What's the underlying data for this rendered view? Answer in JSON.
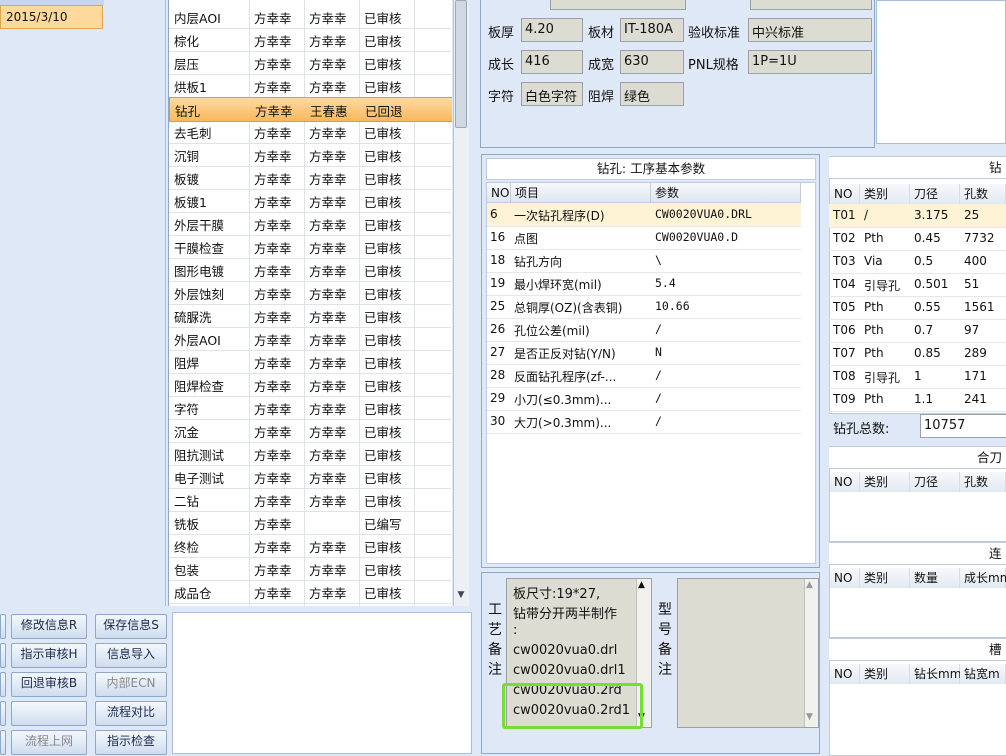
{
  "left_panel": {
    "date": "2015/3/10"
  },
  "process_rows": [
    [
      "内层AOI",
      "方幸幸",
      "方幸幸",
      "已审核"
    ],
    [
      "棕化",
      "方幸幸",
      "方幸幸",
      "已审核"
    ],
    [
      "层压",
      "方幸幸",
      "方幸幸",
      "已审核"
    ],
    [
      "烘板1",
      "方幸幸",
      "方幸幸",
      "已审核"
    ],
    [
      "钻孔",
      "方幸幸",
      "王春惠",
      "已回退"
    ],
    [
      "去毛刺",
      "方幸幸",
      "方幸幸",
      "已审核"
    ],
    [
      "沉铜",
      "方幸幸",
      "方幸幸",
      "已审核"
    ],
    [
      "板镀",
      "方幸幸",
      "方幸幸",
      "已审核"
    ],
    [
      "板镀1",
      "方幸幸",
      "方幸幸",
      "已审核"
    ],
    [
      "外层干膜",
      "方幸幸",
      "方幸幸",
      "已审核"
    ],
    [
      "干膜检查",
      "方幸幸",
      "方幸幸",
      "已审核"
    ],
    [
      "图形电镀",
      "方幸幸",
      "方幸幸",
      "已审核"
    ],
    [
      "外层蚀刻",
      "方幸幸",
      "方幸幸",
      "已审核"
    ],
    [
      "硫脲洗",
      "方幸幸",
      "方幸幸",
      "已审核"
    ],
    [
      "外层AOI",
      "方幸幸",
      "方幸幸",
      "已审核"
    ],
    [
      "阻焊",
      "方幸幸",
      "方幸幸",
      "已审核"
    ],
    [
      "阻焊检查",
      "方幸幸",
      "方幸幸",
      "已审核"
    ],
    [
      "字符",
      "方幸幸",
      "方幸幸",
      "已审核"
    ],
    [
      "沉金",
      "方幸幸",
      "方幸幸",
      "已审核"
    ],
    [
      "阻抗测试",
      "方幸幸",
      "方幸幸",
      "已审核"
    ],
    [
      "电子测试",
      "方幸幸",
      "方幸幸",
      "已审核"
    ],
    [
      "二钻",
      "方幸幸",
      "方幸幸",
      "已审核"
    ],
    [
      "铣板",
      "方幸幸",
      "",
      "已编写"
    ],
    [
      "终检",
      "方幸幸",
      "方幸幸",
      "已审核"
    ],
    [
      "包装",
      "方幸幸",
      "方幸幸",
      "已审核"
    ],
    [
      "成品仓",
      "方幸幸",
      "方幸幸",
      "已审核"
    ]
  ],
  "buttons": {
    "modify_info": "修改信息R",
    "save_info": "保存信息S",
    "instruct_review": "指示审核H",
    "info_import": "信息导入",
    "return_review": "回退审核B",
    "internal_ecn": "内部ECN",
    "flow_compare": "流程对比",
    "flow_online": "流程上网",
    "instruct_check": "指示检查"
  },
  "info": {
    "thickness_label": "板厚",
    "thickness": "4.20",
    "material_label": "板材",
    "material": "IT-180A",
    "standard_label": "验收标准",
    "standard": "中兴标准",
    "growth_label": "成长",
    "growth": "416",
    "finish_label": "成宽",
    "finish": "630",
    "pnl_label": "PNL规格",
    "pnl": "1P=1U",
    "char_label": "字符",
    "char": "白色字符",
    "mask_label": "阻焊",
    "mask": "绿色"
  },
  "param": {
    "title": "钻孔: 工序基本参数",
    "headers": [
      "NO",
      "项目",
      "参数"
    ],
    "rows": [
      [
        "6",
        "一次钻孔程序(D)",
        "CW0020VUA0.DRL"
      ],
      [
        "16",
        "点图",
        "CW0020VUA0.D"
      ],
      [
        "18",
        "钻孔方向",
        "\\"
      ],
      [
        "19",
        "最小焊环宽(mil)",
        "5.4"
      ],
      [
        "25",
        "总铜厚(OZ)(含表铜)",
        "10.66"
      ],
      [
        "26",
        "孔位公差(mil)",
        "/"
      ],
      [
        "27",
        "是否正反对钻(Y/N)",
        "N"
      ],
      [
        "28",
        "反面钻孔程序(zf-...",
        "/"
      ],
      [
        "29",
        "小刀(≤0.3mm)...",
        "/"
      ],
      [
        "30",
        "大刀(>0.3mm)...",
        "/"
      ]
    ]
  },
  "notes": {
    "process_label": "工艺备注",
    "model_label": "型号备注",
    "lines": [
      "板尺寸:19*27,",
      "钻带分开两半制作",
      ":",
      "cw0020vua0.drl",
      "cw0020vua0.drl1",
      "cw0020vua0.2rd",
      "cw0020vua0.2rd1"
    ]
  },
  "tools": {
    "title": "钻",
    "headers": [
      "NO",
      "类别",
      "刀径",
      "孔数"
    ],
    "rows": [
      [
        "T01",
        "/",
        "3.175",
        "25"
      ],
      [
        "T02",
        "Pth",
        "0.45",
        "7732"
      ],
      [
        "T03",
        "Via",
        "0.5",
        "400"
      ],
      [
        "T04",
        "引导孔",
        "0.501",
        "51"
      ],
      [
        "T05",
        "Pth",
        "0.55",
        "1561"
      ],
      [
        "T06",
        "Pth",
        "0.7",
        "97"
      ],
      [
        "T07",
        "Pth",
        "0.85",
        "289"
      ],
      [
        "T08",
        "引导孔",
        "1",
        "171"
      ],
      [
        "T09",
        "Pth",
        "1.1",
        "241"
      ]
    ],
    "total_label": "钻孔总数:",
    "total": "10757"
  },
  "combo": {
    "title": "合刀",
    "headers": [
      "NO",
      "类别",
      "刀径",
      "孔数"
    ]
  },
  "link": {
    "title": "连",
    "headers": [
      "NO",
      "类别",
      "数量",
      "成长mm"
    ]
  },
  "slot": {
    "title": "槽",
    "headers": [
      "NO",
      "类别",
      "钻长mm",
      "钻宽m"
    ]
  }
}
